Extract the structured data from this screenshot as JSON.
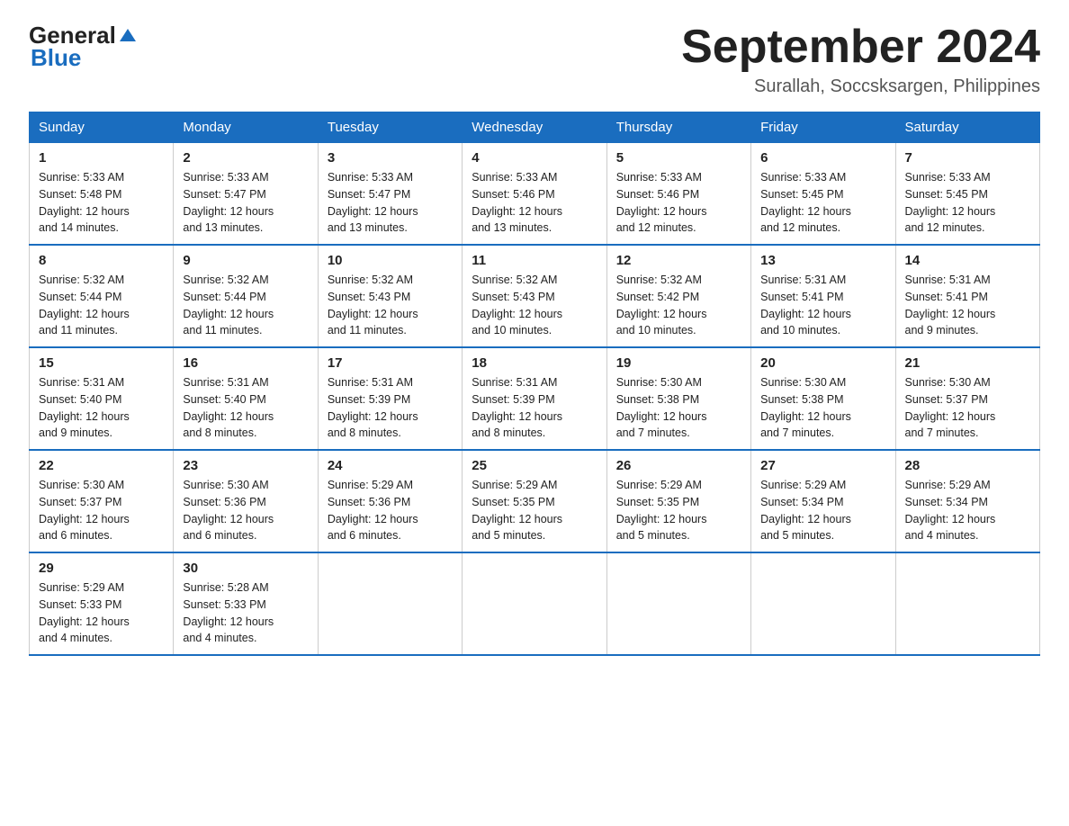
{
  "logo": {
    "general": "General",
    "blue": "Blue"
  },
  "title": "September 2024",
  "location": "Surallah, Soccsksargen, Philippines",
  "weekdays": [
    "Sunday",
    "Monday",
    "Tuesday",
    "Wednesday",
    "Thursday",
    "Friday",
    "Saturday"
  ],
  "weeks": [
    [
      {
        "day": "1",
        "sunrise": "5:33 AM",
        "sunset": "5:48 PM",
        "daylight": "12 hours and 14 minutes."
      },
      {
        "day": "2",
        "sunrise": "5:33 AM",
        "sunset": "5:47 PM",
        "daylight": "12 hours and 13 minutes."
      },
      {
        "day": "3",
        "sunrise": "5:33 AM",
        "sunset": "5:47 PM",
        "daylight": "12 hours and 13 minutes."
      },
      {
        "day": "4",
        "sunrise": "5:33 AM",
        "sunset": "5:46 PM",
        "daylight": "12 hours and 13 minutes."
      },
      {
        "day": "5",
        "sunrise": "5:33 AM",
        "sunset": "5:46 PM",
        "daylight": "12 hours and 12 minutes."
      },
      {
        "day": "6",
        "sunrise": "5:33 AM",
        "sunset": "5:45 PM",
        "daylight": "12 hours and 12 minutes."
      },
      {
        "day": "7",
        "sunrise": "5:33 AM",
        "sunset": "5:45 PM",
        "daylight": "12 hours and 12 minutes."
      }
    ],
    [
      {
        "day": "8",
        "sunrise": "5:32 AM",
        "sunset": "5:44 PM",
        "daylight": "12 hours and 11 minutes."
      },
      {
        "day": "9",
        "sunrise": "5:32 AM",
        "sunset": "5:44 PM",
        "daylight": "12 hours and 11 minutes."
      },
      {
        "day": "10",
        "sunrise": "5:32 AM",
        "sunset": "5:43 PM",
        "daylight": "12 hours and 11 minutes."
      },
      {
        "day": "11",
        "sunrise": "5:32 AM",
        "sunset": "5:43 PM",
        "daylight": "12 hours and 10 minutes."
      },
      {
        "day": "12",
        "sunrise": "5:32 AM",
        "sunset": "5:42 PM",
        "daylight": "12 hours and 10 minutes."
      },
      {
        "day": "13",
        "sunrise": "5:31 AM",
        "sunset": "5:41 PM",
        "daylight": "12 hours and 10 minutes."
      },
      {
        "day": "14",
        "sunrise": "5:31 AM",
        "sunset": "5:41 PM",
        "daylight": "12 hours and 9 minutes."
      }
    ],
    [
      {
        "day": "15",
        "sunrise": "5:31 AM",
        "sunset": "5:40 PM",
        "daylight": "12 hours and 9 minutes."
      },
      {
        "day": "16",
        "sunrise": "5:31 AM",
        "sunset": "5:40 PM",
        "daylight": "12 hours and 8 minutes."
      },
      {
        "day": "17",
        "sunrise": "5:31 AM",
        "sunset": "5:39 PM",
        "daylight": "12 hours and 8 minutes."
      },
      {
        "day": "18",
        "sunrise": "5:31 AM",
        "sunset": "5:39 PM",
        "daylight": "12 hours and 8 minutes."
      },
      {
        "day": "19",
        "sunrise": "5:30 AM",
        "sunset": "5:38 PM",
        "daylight": "12 hours and 7 minutes."
      },
      {
        "day": "20",
        "sunrise": "5:30 AM",
        "sunset": "5:38 PM",
        "daylight": "12 hours and 7 minutes."
      },
      {
        "day": "21",
        "sunrise": "5:30 AM",
        "sunset": "5:37 PM",
        "daylight": "12 hours and 7 minutes."
      }
    ],
    [
      {
        "day": "22",
        "sunrise": "5:30 AM",
        "sunset": "5:37 PM",
        "daylight": "12 hours and 6 minutes."
      },
      {
        "day": "23",
        "sunrise": "5:30 AM",
        "sunset": "5:36 PM",
        "daylight": "12 hours and 6 minutes."
      },
      {
        "day": "24",
        "sunrise": "5:29 AM",
        "sunset": "5:36 PM",
        "daylight": "12 hours and 6 minutes."
      },
      {
        "day": "25",
        "sunrise": "5:29 AM",
        "sunset": "5:35 PM",
        "daylight": "12 hours and 5 minutes."
      },
      {
        "day": "26",
        "sunrise": "5:29 AM",
        "sunset": "5:35 PM",
        "daylight": "12 hours and 5 minutes."
      },
      {
        "day": "27",
        "sunrise": "5:29 AM",
        "sunset": "5:34 PM",
        "daylight": "12 hours and 5 minutes."
      },
      {
        "day": "28",
        "sunrise": "5:29 AM",
        "sunset": "5:34 PM",
        "daylight": "12 hours and 4 minutes."
      }
    ],
    [
      {
        "day": "29",
        "sunrise": "5:29 AM",
        "sunset": "5:33 PM",
        "daylight": "12 hours and 4 minutes."
      },
      {
        "day": "30",
        "sunrise": "5:28 AM",
        "sunset": "5:33 PM",
        "daylight": "12 hours and 4 minutes."
      },
      null,
      null,
      null,
      null,
      null
    ]
  ],
  "labels": {
    "sunrise": "Sunrise:",
    "sunset": "Sunset:",
    "daylight": "Daylight:"
  }
}
